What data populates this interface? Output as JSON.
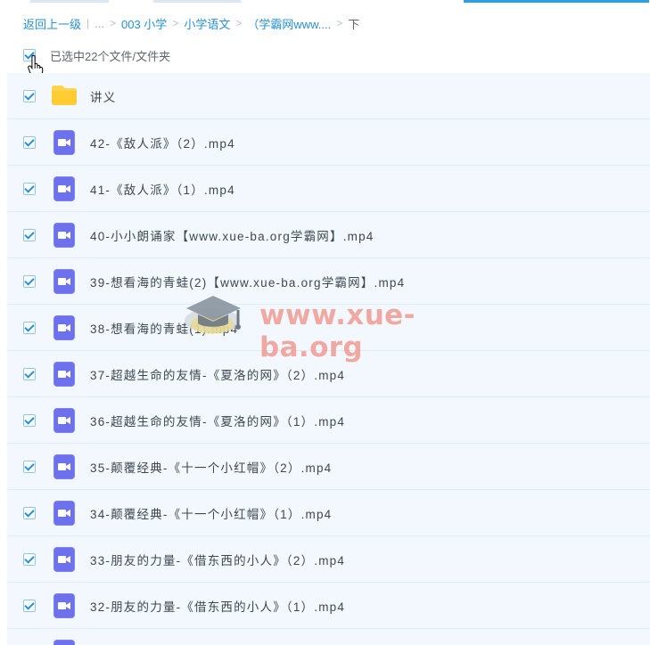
{
  "breadcrumb": {
    "back": "返回上一级",
    "ellipsis": "...",
    "items": [
      "003 小学",
      "小学语文",
      "（学霸网www....",
      "下"
    ]
  },
  "selection": {
    "label": "已选中22个文件/文件夹"
  },
  "files": [
    {
      "name": "讲义",
      "type": "folder"
    },
    {
      "name": "42-《敌人派》（2）.mp4",
      "type": "video"
    },
    {
      "name": "41-《敌人派》（1）.mp4",
      "type": "video"
    },
    {
      "name": "40-小小朗诵家【www.xue-ba.org学霸网】.mp4",
      "type": "video"
    },
    {
      "name": "39-想看海的青蛙(2)【www.xue-ba.org学霸网】.mp4",
      "type": "video"
    },
    {
      "name": "38-想看海的青蛙(1).mp4",
      "type": "video"
    },
    {
      "name": "37-超越生命的友情-《夏洛的网》（2）.mp4",
      "type": "video"
    },
    {
      "name": "36-超越生命的友情-《夏洛的网》（1）.mp4",
      "type": "video"
    },
    {
      "name": "35-颠覆经典-《十一个小红帽》（2）.mp4",
      "type": "video"
    },
    {
      "name": "34-颠覆经典-《十一个小红帽》（1）.mp4",
      "type": "video"
    },
    {
      "name": "33-朋友的力量-《借东西的小人》（2）.mp4",
      "type": "video"
    },
    {
      "name": "32-朋友的力量-《借东西的小人》（1）.mp4",
      "type": "video"
    },
    {
      "name": "",
      "type": "video"
    }
  ],
  "watermark": {
    "text": "www.xue-ba.org"
  },
  "colors": {
    "link": "#2590d8",
    "row_bg": "#f2f8fe",
    "video_icon": "#6e71ee",
    "folder_icon": "#ffd44d",
    "watermark": "#ef8b7f"
  },
  "icons": {
    "folder": "folder-icon",
    "video": "video-file-icon",
    "cursor": "hand-cursor-icon"
  }
}
